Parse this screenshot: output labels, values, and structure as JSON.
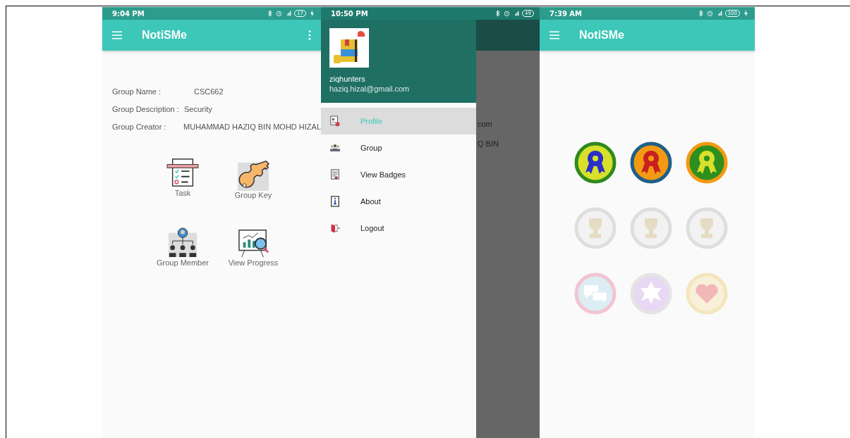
{
  "screens": [
    {
      "kind": "group",
      "status_bar": {
        "time": "9:04 PM",
        "battery": "17",
        "charging": true
      },
      "app_bar": {
        "title": "NotiSMe",
        "overflow_menu": true
      },
      "details": [
        {
          "label": "Group Name :",
          "value": "CSC662"
        },
        {
          "label": "Group Description :",
          "value": "Security"
        },
        {
          "label": "Group Creator :",
          "value": "MUHAMMAD HAZIQ BIN MOHD HIZAL"
        }
      ],
      "actions": [
        {
          "kind": "task",
          "label": "Task"
        },
        {
          "kind": "key",
          "label": "Group Key"
        },
        {
          "kind": "members",
          "label": "Group Member"
        },
        {
          "kind": "progress",
          "label": "View Progress"
        }
      ]
    },
    {
      "kind": "drawer",
      "status_bar": {
        "time": "10:50 PM",
        "battery": "49",
        "charging": false
      },
      "background_fragments": [
        "com",
        "Q BIN"
      ],
      "header": {
        "username": "ziqhunters",
        "email": "haziq.hizal@gmail.com"
      },
      "menu": [
        {
          "kind": "profile",
          "label": "Profile",
          "selected": true
        },
        {
          "kind": "group",
          "label": "Group",
          "selected": false
        },
        {
          "kind": "badges",
          "label": "View Badges",
          "selected": false
        },
        {
          "kind": "about",
          "label": "About",
          "selected": false
        },
        {
          "kind": "logout",
          "label": "Logout",
          "selected": false
        }
      ]
    },
    {
      "kind": "badges",
      "status_bar": {
        "time": "7:39 AM",
        "battery": "100",
        "charging": true
      },
      "app_bar": {
        "title": "NotiSMe",
        "overflow_menu": false
      },
      "badges": [
        {
          "kind": "ribbon",
          "earned": true,
          "color": "#d8e02c"
        },
        {
          "kind": "ribbon",
          "earned": true,
          "color": "#f39a12"
        },
        {
          "kind": "ribbon",
          "earned": true,
          "color": "#2e8f1f"
        },
        {
          "kind": "trophy",
          "earned": false,
          "color": "#f2f2f2"
        },
        {
          "kind": "trophy",
          "earned": false,
          "color": "#f2f2f2"
        },
        {
          "kind": "trophy",
          "earned": false,
          "color": "#f2f2f2"
        },
        {
          "kind": "chat",
          "earned": false,
          "color": "#dcedf3"
        },
        {
          "kind": "star",
          "earned": false,
          "color": "#e8d8f3"
        },
        {
          "kind": "heart",
          "earned": false,
          "color": "#f8f0d8"
        }
      ]
    }
  ]
}
